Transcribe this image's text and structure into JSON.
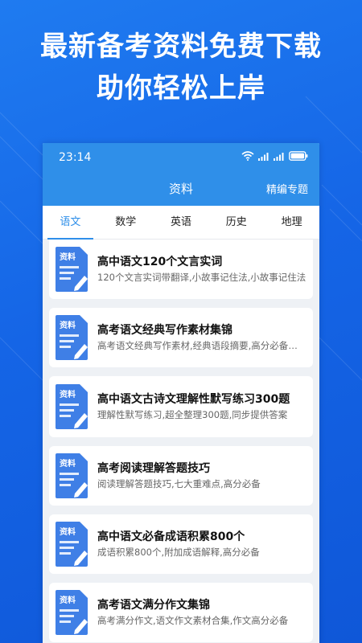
{
  "promo": {
    "line1": "最新备考资料免费下载",
    "line2": "助你轻松上岸"
  },
  "status": {
    "time": "23:14",
    "icons": [
      "wifi-icon",
      "signal-icon",
      "signal-icon",
      "battery-icon"
    ]
  },
  "nav": {
    "title": "资料",
    "right_action": "精编专题"
  },
  "tabs": [
    {
      "label": "语文",
      "active": true
    },
    {
      "label": "数学",
      "active": false
    },
    {
      "label": "英语",
      "active": false
    },
    {
      "label": "历史",
      "active": false
    },
    {
      "label": "地理",
      "active": false
    }
  ],
  "badge_label": "资料",
  "items": [
    {
      "title": "高中语文120个文言实词",
      "desc": "120个文言实词带翻译,小故事记住法,小故事记住法"
    },
    {
      "title": "高考语文经典写作素材集锦",
      "desc": "高考语文经典写作素材,经典语段摘要,高分必备素材"
    },
    {
      "title": "高中语文古诗文理解性默写练习300题",
      "desc": "理解性默写练习,超全整理300题,同步提供答案"
    },
    {
      "title": "高考阅读理解答题技巧",
      "desc": "阅读理解答题技巧,七大重难点,高分必备"
    },
    {
      "title": "高中语文必备成语积累800个",
      "desc": "成语积累800个,附加成语解释,高分必备"
    },
    {
      "title": "高考语文满分作文集锦",
      "desc": "高考满分作文,语文作文素材合集,作文高分必备"
    }
  ],
  "colors": {
    "background": "#1565e6",
    "appbar": "#2f8fe9",
    "accent": "#2f8fe9",
    "icon_blue": "#3f7fe6"
  }
}
